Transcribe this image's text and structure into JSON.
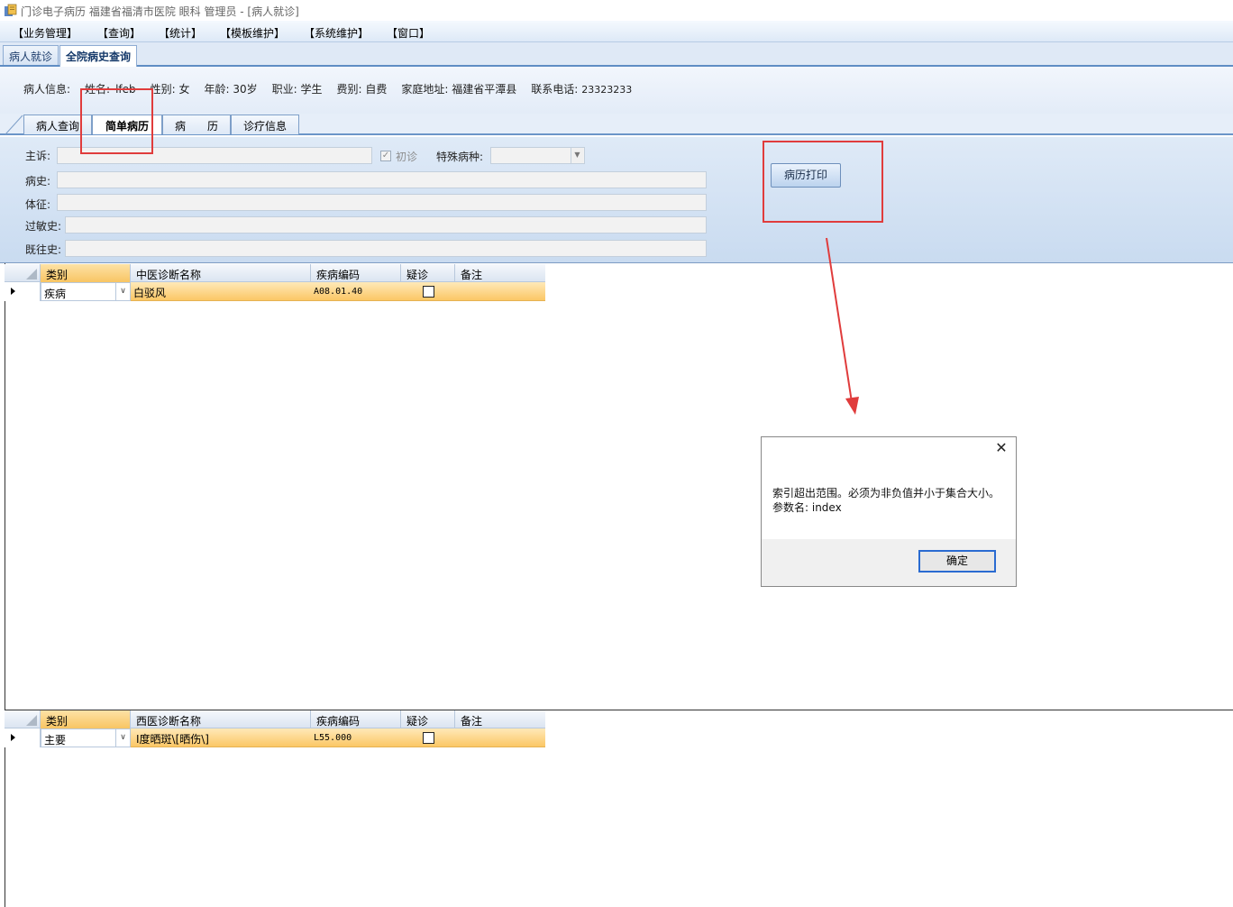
{
  "window": {
    "title": "门诊电子病历  福建省福清市医院  眼科  管理员 - [病人就诊]",
    "icon": "app-icon"
  },
  "menu": [
    "【业务管理】",
    "【查询】",
    "【统计】",
    "【模板维护】",
    "【系统维护】",
    "【窗口】"
  ],
  "outer_tabs": [
    {
      "label": "病人就诊",
      "active": false
    },
    {
      "label": "全院病史查询",
      "active": true
    }
  ],
  "patient_info": {
    "prefix": "病人信息:",
    "name_label": "姓名:",
    "name_value": "lfeb",
    "sex": "性别: 女",
    "age": "年龄: 30岁",
    "occupation": "职业: 学生",
    "fee": "费别: 自费",
    "address": "家庭地址: 福建省平潭县",
    "phone_label": "联系电话:",
    "phone_value": "23323233"
  },
  "inner_tabs": [
    {
      "label": "病人查询",
      "active": false
    },
    {
      "label": "简单病历",
      "active": true
    },
    {
      "label": "病　　历",
      "active": false
    },
    {
      "label": "诊疗信息",
      "active": false
    }
  ],
  "form": {
    "chief_complaint_label": "主诉:",
    "chief_complaint_value": "",
    "first_visit_label": "初诊",
    "first_visit_checked": true,
    "special_disease_label": "特殊病种:",
    "special_disease_value": "",
    "history_label": "病史:",
    "history_value": "",
    "signs_label": "体征:",
    "signs_value": "",
    "allergy_label": "过敏史:",
    "allergy_value": "",
    "past_history_label": "既往史:",
    "past_history_value": ""
  },
  "print_button": "病历打印",
  "tcm_grid": {
    "headers": [
      "类别",
      "中医诊断名称",
      "疾病编码",
      "疑诊",
      "备注"
    ],
    "rows": [
      {
        "category": "疾病",
        "name": "白驳风",
        "code": "A08.01.40",
        "suspected": false,
        "note": ""
      }
    ]
  },
  "western_grid": {
    "headers": [
      "类别",
      "西医诊断名称",
      "疾病编码",
      "疑诊",
      "备注"
    ],
    "rows": [
      {
        "category": "主要",
        "name": "Ⅰ度晒斑\\[晒伤\\]",
        "code": "L55.000",
        "suspected": false,
        "note": ""
      }
    ]
  },
  "dialog": {
    "message_line1": "索引超出范围。必须为非负值并小于集合大小。",
    "message_line2": "参数名: index",
    "ok_label": "确定",
    "close_icon": "close-icon"
  },
  "colors": {
    "annotation": "#e03c3c",
    "selection": "#fbc766",
    "tab_accent": "#5f8dc4"
  }
}
